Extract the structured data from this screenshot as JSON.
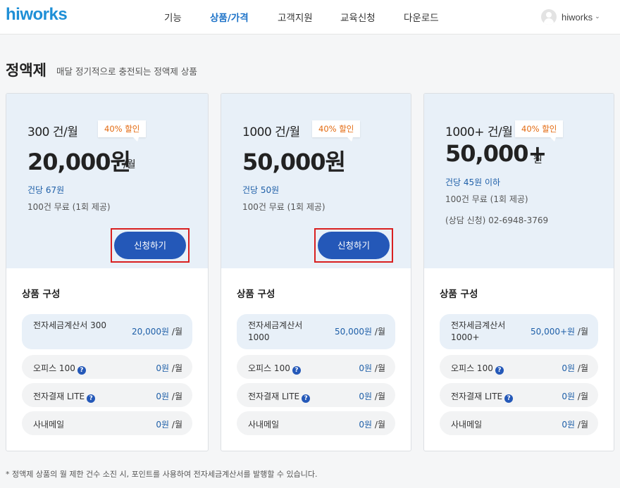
{
  "header": {
    "logo": "hiworks",
    "nav": [
      "기능",
      "상품/가격",
      "고객지원",
      "교육신청",
      "다운로드"
    ],
    "active_nav": "상품/가격",
    "user_name": "hiworks",
    "user_chevron": "⌄"
  },
  "section": {
    "title": "정액제",
    "subtitle": "매달 정기적으로 충전되는 정액제 상품"
  },
  "plans": [
    {
      "unit": "300 건/월",
      "badge": "40% 할인",
      "price": "20,000원",
      "per_month": "/월",
      "per_count": "건당 67원",
      "free": "100건 무료 (1회 제공)",
      "apply_label": "신청하기",
      "composition_title": "상품 구성",
      "items": [
        {
          "label": "전자세금계산서 300",
          "value": "20,000원",
          "unit": "/월"
        },
        {
          "label": "오피스 100",
          "value": "0원",
          "unit": "/월"
        },
        {
          "label": "전자결재 LITE",
          "value": "0원",
          "unit": "/월"
        },
        {
          "label": "사내메일",
          "value": "0원",
          "unit": "/월"
        }
      ]
    },
    {
      "unit": "1000 건/월",
      "badge": "40% 할인",
      "price": "50,000원",
      "per_count": "건당 50원",
      "free": "100건 무료 (1회 제공)",
      "apply_label": "신청하기",
      "composition_title": "상품 구성",
      "items": [
        {
          "label": "전자세금계산서 1000",
          "value": "50,000원",
          "unit": "/월"
        },
        {
          "label": "오피스 100",
          "value": "0원",
          "unit": "/월"
        },
        {
          "label": "전자결재 LITE",
          "value": "0원",
          "unit": "/월"
        },
        {
          "label": "사내메일",
          "value": "0원",
          "unit": "/월"
        }
      ]
    },
    {
      "unit": "1000+ 건/월",
      "badge": "40% 할인",
      "price": "50,000+",
      "price_suffix": "원",
      "per_count": "건당 45원 이하",
      "free": "100건 무료 (1회 제공)",
      "contact": "(상담 신청) 02-6948-3769",
      "composition_title": "상품 구성",
      "items": [
        {
          "label": "전자세금계산서 1000+",
          "value": "50,000+원",
          "unit": "/월"
        },
        {
          "label": "오피스 100",
          "value": "0원",
          "unit": "/월"
        },
        {
          "label": "전자결재 LITE",
          "value": "0원",
          "unit": "/월"
        },
        {
          "label": "사내메일",
          "value": "0원",
          "unit": "/월"
        }
      ]
    }
  ],
  "help_icon_glyph": "?",
  "icons": {
    "help": "question-circle-icon",
    "avatar": "user-avatar-icon",
    "dropdown": "chevron-down-icon"
  },
  "colors": {
    "brand": "#1e8fd6",
    "primary_button": "#2458b8",
    "badge_text": "#e36a10",
    "card_top_bg": "#e8f0f8",
    "highlight_border": "#d92020"
  },
  "footnote": "* 정액제 상품의 월 제한 건수 소진 시, 포인트를 사용하여 전자세금계산서를 발행할 수 있습니다."
}
